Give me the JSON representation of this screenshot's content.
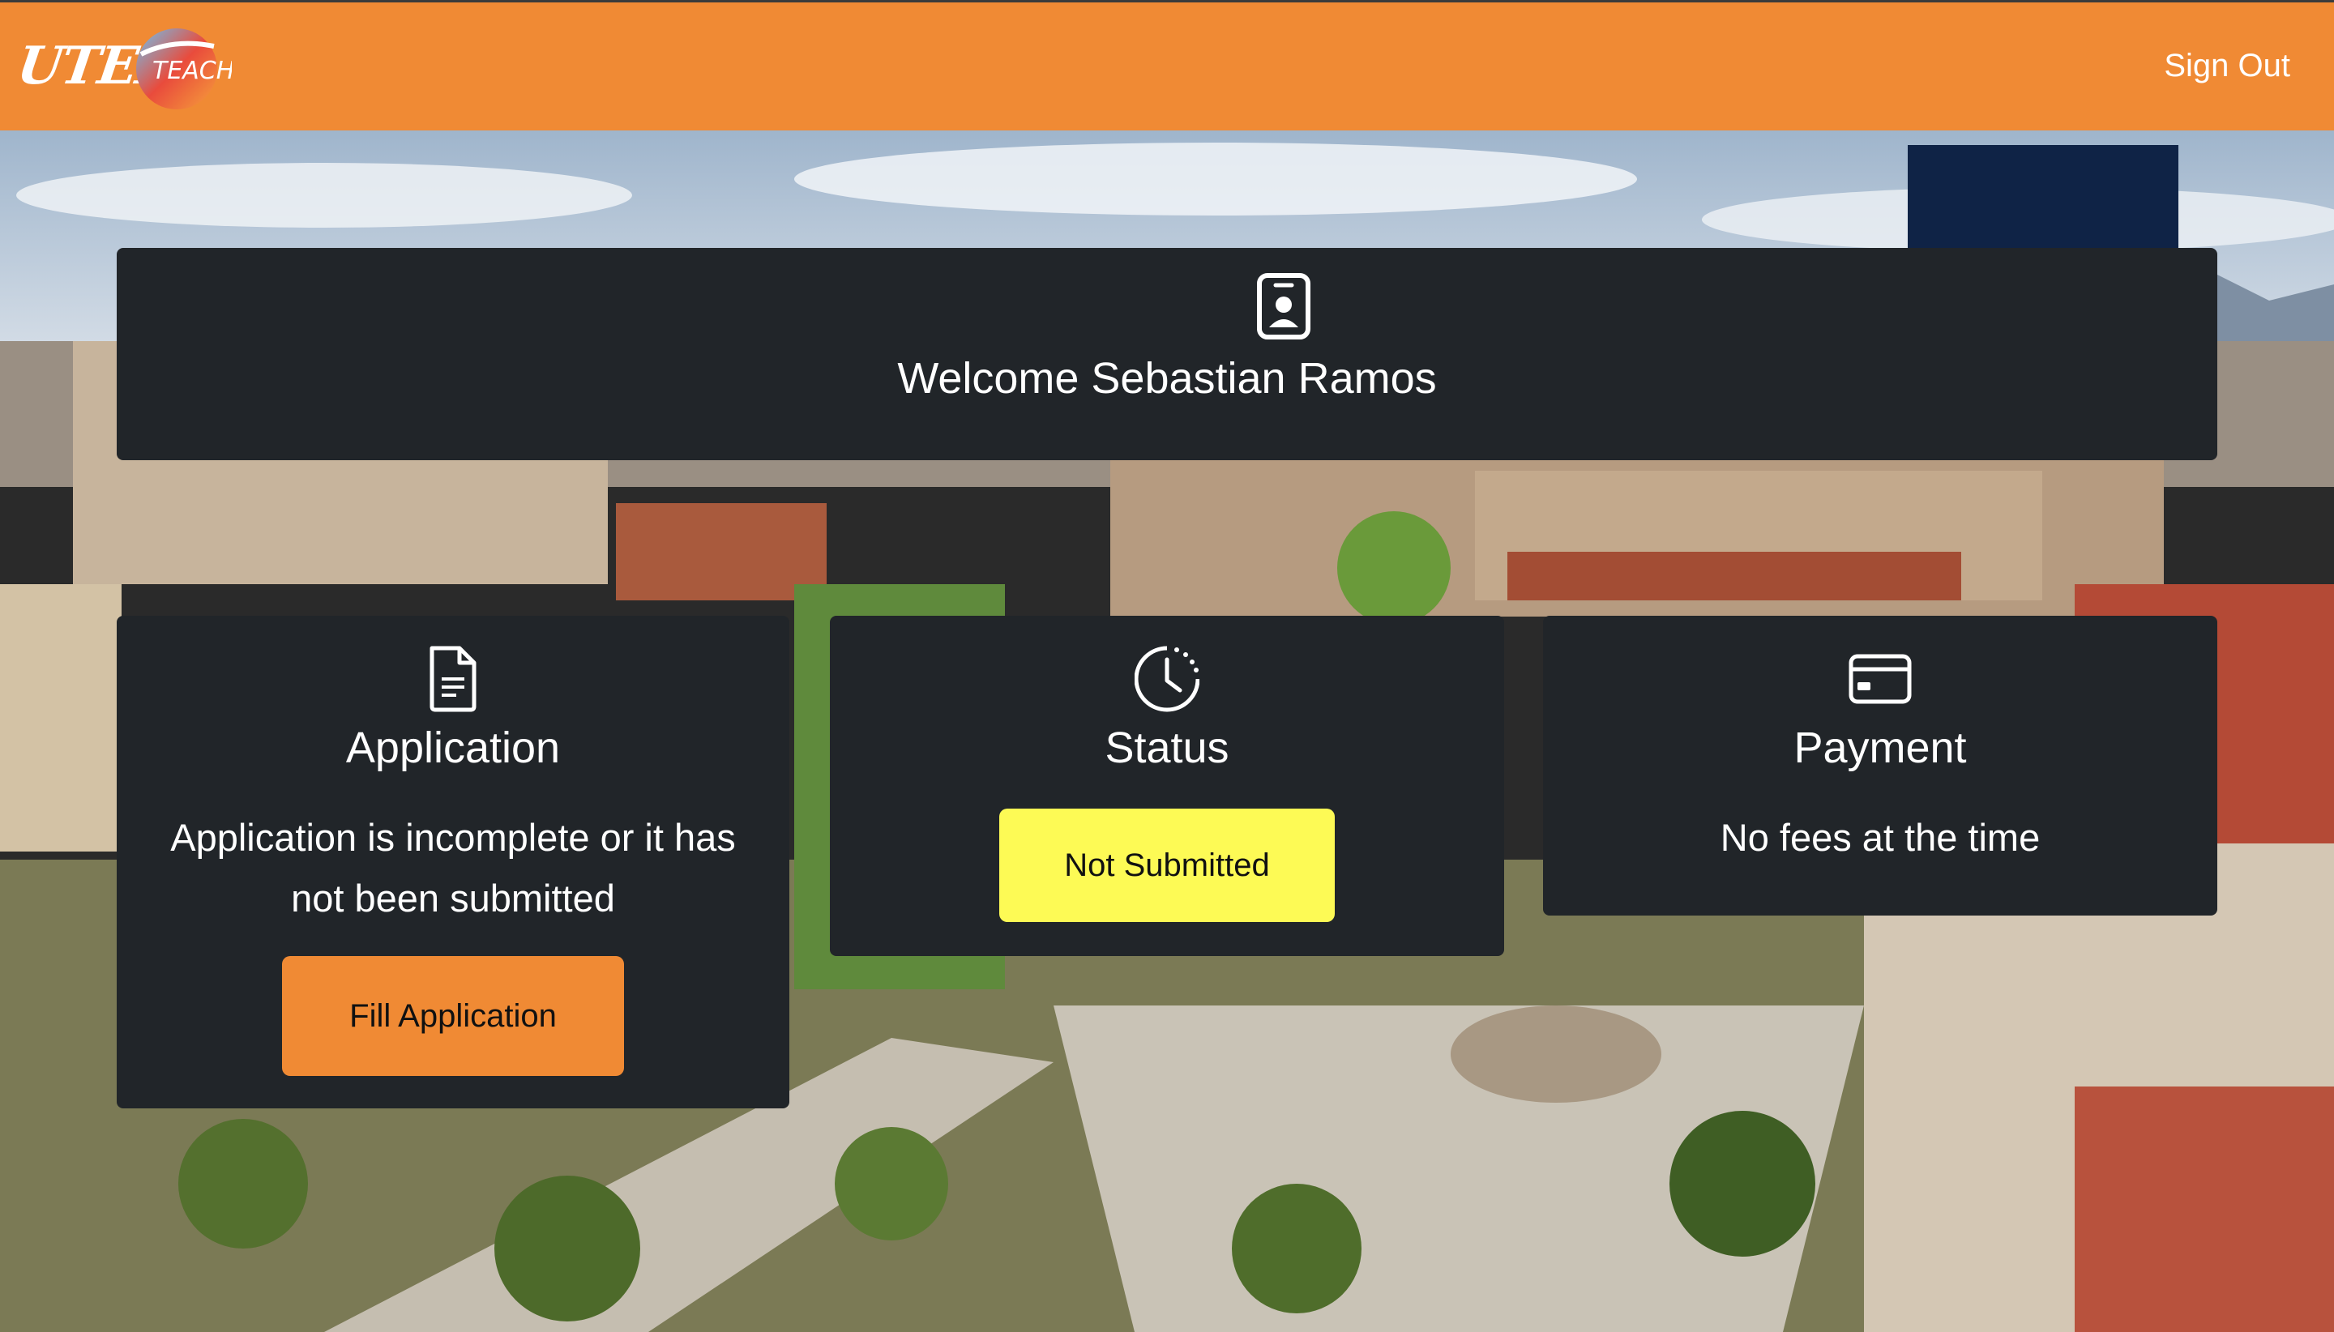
{
  "header": {
    "logo_text": "UTEP",
    "logo2_text": "TEACH",
    "sign_out": "Sign Out"
  },
  "welcome": {
    "icon": "person-badge-icon",
    "title": "Welcome Sebastian Ramos"
  },
  "application": {
    "icon": "document-icon",
    "title": "Application",
    "text": "Application is incomplete or it has not been submitted",
    "button": "Fill Application"
  },
  "status": {
    "icon": "clock-icon",
    "title": "Status",
    "badge": "Not Submitted"
  },
  "payment": {
    "icon": "credit-card-icon",
    "title": "Payment",
    "text": "No fees at the time"
  },
  "colors": {
    "brand_orange": "#f08a34",
    "card_bg": "#212529",
    "status_yellow": "#fdfa55"
  }
}
